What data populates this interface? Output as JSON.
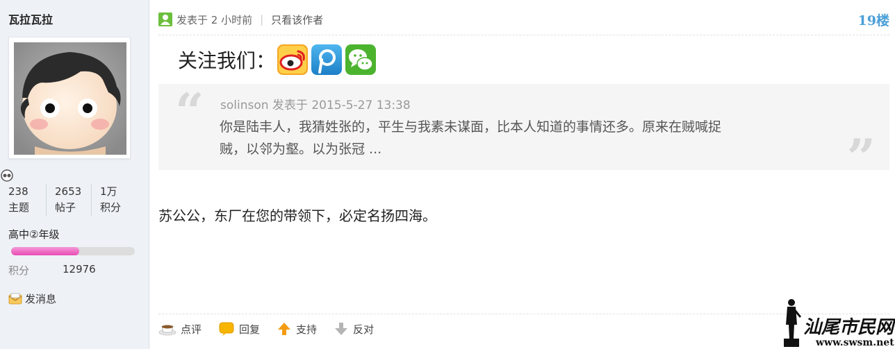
{
  "sidebar": {
    "username": "瓦拉瓦拉",
    "stats": [
      {
        "num": "238",
        "label": "主题"
      },
      {
        "num": "2653",
        "label": "帖子"
      },
      {
        "num": "1万",
        "label": "积分"
      }
    ],
    "level": "高中②年级",
    "level_progress": 0.55,
    "credit_label": "积分",
    "credit_value": "12976",
    "send_message": "发消息"
  },
  "post": {
    "posted": "发表于 2 小时前",
    "separator": "|",
    "only_author": "只看该作者",
    "floor": "19楼",
    "follow_label": "关注我们：",
    "social_icons": [
      "weibo-icon",
      "tencent-weibo-icon",
      "wechat-icon"
    ],
    "quote": {
      "meta": "solinson 发表于 2015-5-27 13:38",
      "line1": "你是陆丰人，我猜姓张的，平生与我素未谋面，比本人知道的事情还多。原来在贼喊捉",
      "line2": "贼，以邻为壑。以为张冠 ..."
    },
    "body": "苏公公，东厂在您的带领下，必定名扬四海。",
    "actions": {
      "comment": "点评",
      "reply": "回复",
      "support": "支持",
      "oppose": "反对"
    }
  },
  "watermark": {
    "text": "汕尾市民网",
    "url": "www.swsm.net"
  },
  "colors": {
    "floor": "#4a9fd8",
    "sidebar_bg": "#eef2f7",
    "progress": "#e84bb4"
  }
}
